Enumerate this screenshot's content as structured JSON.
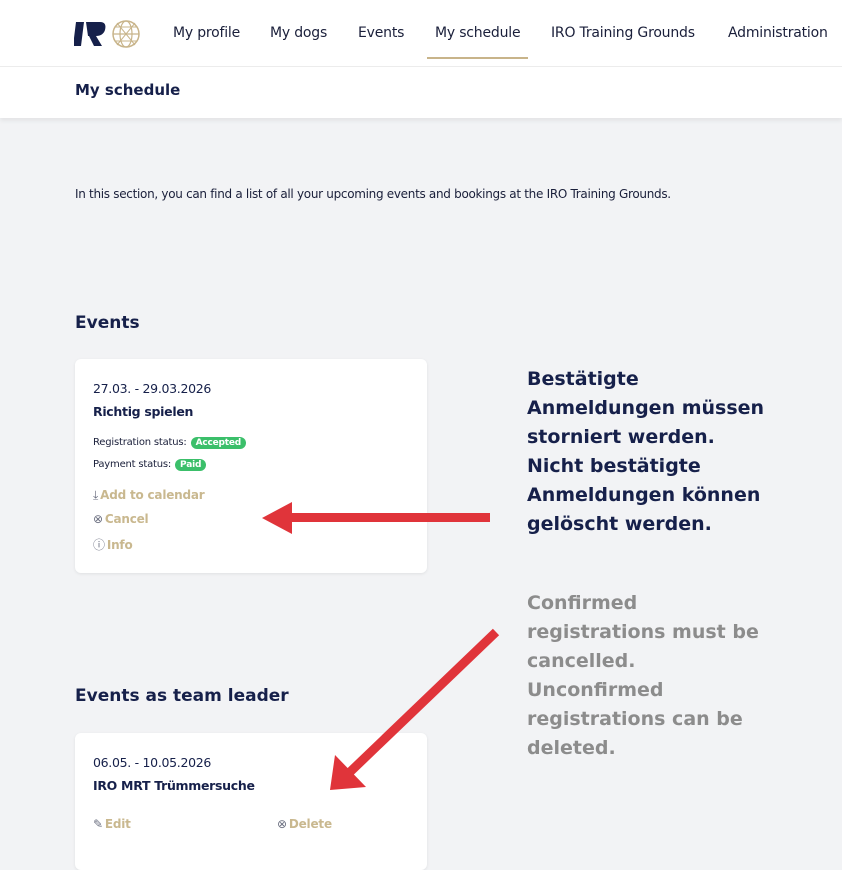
{
  "nav": {
    "items": [
      {
        "label": "My profile"
      },
      {
        "label": "My dogs"
      },
      {
        "label": "Events"
      },
      {
        "label": "My schedule"
      },
      {
        "label": "IRO Training Grounds"
      },
      {
        "label": "Administration"
      }
    ],
    "active": "My schedule",
    "accent_color": "#c8b48a"
  },
  "page": {
    "title": "My schedule",
    "intro": "In this section, you can find a list of all your upcoming events and bookings at the IRO Training Grounds."
  },
  "events_section": {
    "title": "Events",
    "card": {
      "dates": "27.03. - 29.03.2026",
      "name": "Richtig spielen",
      "registration_label": "Registration status:",
      "registration_value": "Accepted",
      "payment_label": "Payment status:",
      "payment_value": "Paid",
      "add_calendar": "Add to calendar",
      "cancel": "Cancel",
      "info": "Info"
    }
  },
  "leader_section": {
    "title": "Events as team leader",
    "card": {
      "dates": "06.05. - 10.05.2026",
      "name": "IRO MRT Trümmersuche",
      "edit": "Edit",
      "delete": "Delete"
    }
  },
  "annotations": {
    "german": "Bestätigte\nAnmeldungen müssen\nstorniert werden.\nNicht bestätigte\nAnmeldungen können\ngelöscht werden.",
    "english": "Confirmed\nregistrations must be\ncancelled.\nUnconfirmed\nregistrations can be\ndeleted.",
    "arrow_color": "#e0343a"
  },
  "colors": {
    "badge_green": "#3bbf6a",
    "action_gold": "#c9b88f",
    "navy": "#16204a"
  }
}
